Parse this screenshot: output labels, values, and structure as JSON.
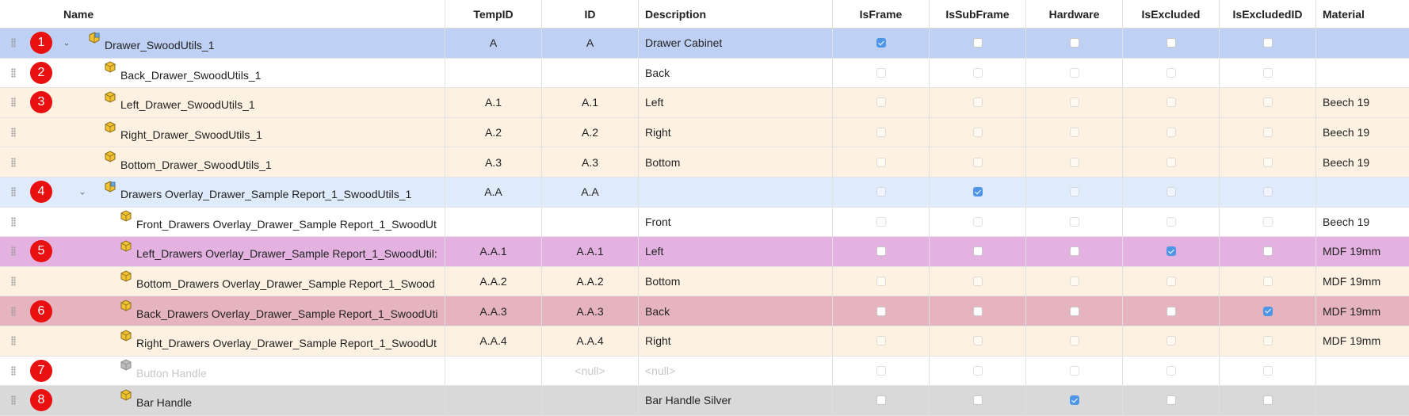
{
  "columns": [
    "Name",
    "TempID",
    "ID",
    "Description",
    "IsFrame",
    "IsSubFrame",
    "Hardware",
    "IsExcluded",
    "IsExcludedID",
    "Material"
  ],
  "rows": [
    {
      "badge": "1",
      "name": "Drawer_SwoodUtils_1",
      "level": 0,
      "expanded": true,
      "tempid": "A",
      "id": "A",
      "description": "Drawer Cabinet",
      "isframe": true,
      "issubframe": false,
      "hardware": false,
      "isexcluded": false,
      "isexcludedid": false,
      "material": "",
      "style": "r-blue",
      "icon": "assembly-icon",
      "dim": false
    },
    {
      "badge": "2",
      "name": "Back_Drawer_SwoodUtils_1",
      "level": 1,
      "tempid": "",
      "id": "",
      "description": "Back",
      "isframe": false,
      "issubframe": false,
      "hardware": false,
      "isexcluded": false,
      "isexcludedid": false,
      "material": "",
      "style": "r-white",
      "icon": "part-icon",
      "dim": true
    },
    {
      "badge": "3",
      "name": "Left_Drawer_SwoodUtils_1",
      "level": 1,
      "tempid": "A.1",
      "id": "A.1",
      "description": "Left",
      "isframe": false,
      "issubframe": false,
      "hardware": false,
      "isexcluded": false,
      "isexcludedid": false,
      "material": "Beech 19",
      "style": "r-cream",
      "icon": "part-icon",
      "dim": true
    },
    {
      "badge": "",
      "name": "Right_Drawer_SwoodUtils_1",
      "level": 1,
      "tempid": "A.2",
      "id": "A.2",
      "description": "Right",
      "isframe": false,
      "issubframe": false,
      "hardware": false,
      "isexcluded": false,
      "isexcludedid": false,
      "material": "Beech 19",
      "style": "r-cream",
      "icon": "part-icon",
      "dim": true
    },
    {
      "badge": "",
      "name": "Bottom_Drawer_SwoodUtils_1",
      "level": 1,
      "tempid": "A.3",
      "id": "A.3",
      "description": "Bottom",
      "isframe": false,
      "issubframe": false,
      "hardware": false,
      "isexcluded": false,
      "isexcludedid": false,
      "material": "Beech 19",
      "style": "r-cream",
      "icon": "part-icon",
      "dim": true
    },
    {
      "badge": "4",
      "name": "Drawers Overlay_Drawer_Sample Report_1_SwoodUtils_1",
      "level": 1,
      "expanded": true,
      "tempid": "A.A",
      "id": "A.A",
      "description": "",
      "isframe": false,
      "issubframe": true,
      "hardware": false,
      "isexcluded": false,
      "isexcludedid": false,
      "material": "",
      "style": "r-light",
      "icon": "assembly-icon",
      "dim": true
    },
    {
      "badge": "",
      "name": "Front_Drawers Overlay_Drawer_Sample Report_1_SwoodUt",
      "level": 2,
      "tempid": "",
      "id": "",
      "description": "Front",
      "isframe": false,
      "issubframe": false,
      "hardware": false,
      "isexcluded": false,
      "isexcludedid": false,
      "material": "Beech 19",
      "style": "r-white",
      "icon": "part-icon",
      "dim": true
    },
    {
      "badge": "5",
      "name": "Left_Drawers Overlay_Drawer_Sample Report_1_SwoodUtil:",
      "level": 2,
      "tempid": "A.A.1",
      "id": "A.A.1",
      "description": "Left",
      "isframe": false,
      "issubframe": false,
      "hardware": false,
      "isexcluded": true,
      "isexcludedid": false,
      "material": "MDF 19mm",
      "style": "r-purple",
      "icon": "part-icon",
      "dim": false
    },
    {
      "badge": "",
      "name": "Bottom_Drawers Overlay_Drawer_Sample Report_1_Swood",
      "level": 2,
      "tempid": "A.A.2",
      "id": "A.A.2",
      "description": "Bottom",
      "isframe": false,
      "issubframe": false,
      "hardware": false,
      "isexcluded": false,
      "isexcludedid": false,
      "material": "MDF 19mm",
      "style": "r-cream",
      "icon": "part-icon",
      "dim": true
    },
    {
      "badge": "6",
      "name": "Back_Drawers Overlay_Drawer_Sample Report_1_SwoodUti",
      "level": 2,
      "tempid": "A.A.3",
      "id": "A.A.3",
      "description": "Back",
      "isframe": false,
      "issubframe": false,
      "hardware": false,
      "isexcluded": false,
      "isexcludedid": true,
      "material": "MDF 19mm",
      "style": "r-pink",
      "icon": "part-icon",
      "dim": false
    },
    {
      "badge": "",
      "name": "Right_Drawers Overlay_Drawer_Sample Report_1_SwoodUt",
      "level": 2,
      "tempid": "A.A.4",
      "id": "A.A.4",
      "description": "Right",
      "isframe": false,
      "issubframe": false,
      "hardware": false,
      "isexcluded": false,
      "isexcludedid": false,
      "material": "MDF 19mm",
      "style": "r-cream",
      "icon": "part-icon",
      "dim": true
    },
    {
      "badge": "7",
      "name": "Button Handle",
      "level": 2,
      "tempid": "",
      "id": "<null>",
      "description": "<null>",
      "isframe": false,
      "issubframe": false,
      "hardware": false,
      "isexcluded": false,
      "isexcludedid": false,
      "material": "",
      "style": "r-white",
      "icon": "part-gray-icon",
      "dim": true,
      "muted": true
    },
    {
      "badge": "8",
      "name": "Bar Handle",
      "level": 2,
      "tempid": "",
      "id": "",
      "description": "Bar Handle Silver",
      "isframe": false,
      "issubframe": false,
      "hardware": true,
      "isexcluded": false,
      "isexcludedid": false,
      "material": "",
      "style": "r-gray",
      "icon": "part-icon",
      "dim": false
    }
  ],
  "colors": {
    "badge": "#e81010",
    "check": "#4f97e6",
    "selected": "#bed1f4"
  }
}
